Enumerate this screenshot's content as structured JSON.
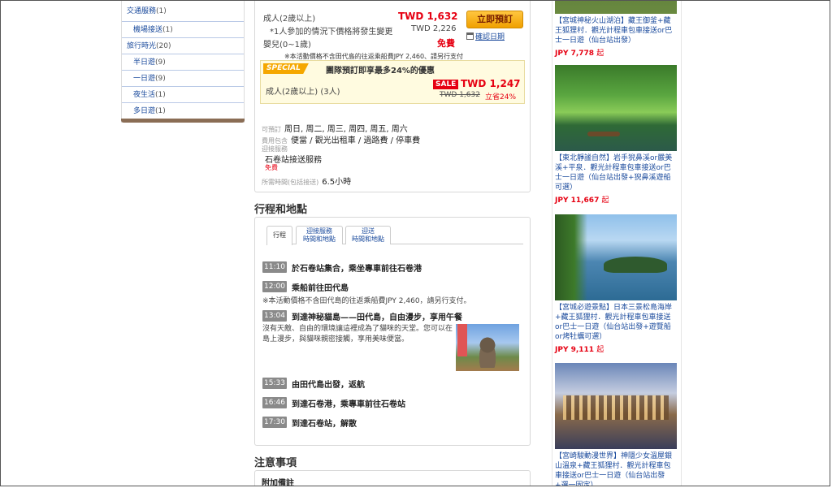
{
  "sidebar": {
    "items": [
      {
        "label": "交通服務",
        "count": "(1)",
        "sub": false
      },
      {
        "label": "機場接送",
        "count": "(1)",
        "sub": true
      },
      {
        "label": "旅行時光",
        "count": "(20)",
        "sub": false
      },
      {
        "label": "半日遊",
        "count": "(9)",
        "sub": true
      },
      {
        "label": "一日遊",
        "count": "(9)",
        "sub": true
      },
      {
        "label": "夜生活",
        "count": "(1)",
        "sub": true
      },
      {
        "label": "多日遊",
        "count": "(1)",
        "sub": true
      }
    ]
  },
  "booking": {
    "adult_label": "成人(2歲以上)",
    "adult_price": "TWD 1,632",
    "book_button": "立即預訂",
    "check_date": "確認日期",
    "note_line": "*1人參加的情況下價格將發生變更",
    "note_price": "TWD 2,226",
    "infant_label": "嬰兒(0~1歲)",
    "infant_price": "免費",
    "boat_note": "※本活動價格不含田代島的往返乘船費JPY 2,460、請另行支付",
    "special": {
      "badge": "SPECIAL",
      "title": "團隊預訂即享最多24%的優惠",
      "row_label": "成人(2歲以上) (3人)",
      "sale_badge": "SALE",
      "sale_price": "TWD 1,247",
      "old_price": "TWD 1,632",
      "saving": "立省24%"
    },
    "bookable_label": "可預訂",
    "bookable_value": "周日, 周二, 周三, 周四, 周五, 周六",
    "includes_label": "費用包含",
    "includes_value": "便當 / 觀光出租車 / 過路費 / 停車費",
    "pickup_label": "迎接服務",
    "pickup_value": "石卷站接送服務",
    "pickup_free": "免費",
    "duration_label": "所需時間(包括接送)",
    "duration_value": "6.5小時"
  },
  "itinerary": {
    "title": "行程和地點",
    "tabs": [
      {
        "label": "行程"
      },
      {
        "line1": "迎接服務",
        "line2": "時間和地點"
      },
      {
        "line1": "迎送",
        "line2": "時間和地點"
      }
    ],
    "steps": [
      {
        "time": "11:10",
        "text": "於石卷站集合，乘坐專車前往石卷港"
      },
      {
        "time": "12:00",
        "text": "乘船前往田代島",
        "note": "※本活動價格不含田代島的往返乘船費JPY 2,460，請另行支付。"
      },
      {
        "time": "13:04",
        "text": "到達神秘貓島——田代島，自由漫步，享用午餐",
        "desc": "沒有天敵、自由的環境讓這裡成為了貓咪的天堂。您可以在島上漫步，與貓咪親密接觸，享用美味便當。"
      },
      {
        "time": "15:33",
        "text": "由田代島出發，返航"
      },
      {
        "time": "16:46",
        "text": "到達石卷港，乘專車前往石卷站"
      },
      {
        "time": "17:30",
        "text": "到達石卷站，解散"
      }
    ]
  },
  "notice": {
    "title": "注意事項",
    "sub_title": "附加備註"
  },
  "products": [
    {
      "title": "【宮城神秘火山湖泊】藏王御釜+藏王狐狸村．觀光計程車包車接送or巴士一日遊（仙台站出發）",
      "price": "JPY 7,778",
      "suffix": "起"
    },
    {
      "title": "【東北靜謐自然】岩手猊鼻溪or嚴美溪+平泉．觀光計程車包車接送or巴士一日遊（仙台站出發+猊鼻溪遊船可選）",
      "price": "JPY 11,667",
      "suffix": "起"
    },
    {
      "title": "【宮城必遊景點】日本三景松島海岸+藏王狐狸村．觀光計程車包車接送or巴士一日遊（仙台站出發+遊覽船or烤牡蠣可選）",
      "price": "JPY 9,111",
      "suffix": "起"
    },
    {
      "title": "【宮崎駿動漫世界】神隱少女溫屋銀山溫泉+藏王狐狸村．觀光計程車包車接送or巴士一日遊（仙台站出發+選一固定）",
      "price": "",
      "suffix": ""
    }
  ],
  "colors": {
    "accent_red": "#e60012",
    "link_blue": "#1a4a9c",
    "button_orange": "#f5a700",
    "sidebar_bar": "#8a6d55"
  }
}
